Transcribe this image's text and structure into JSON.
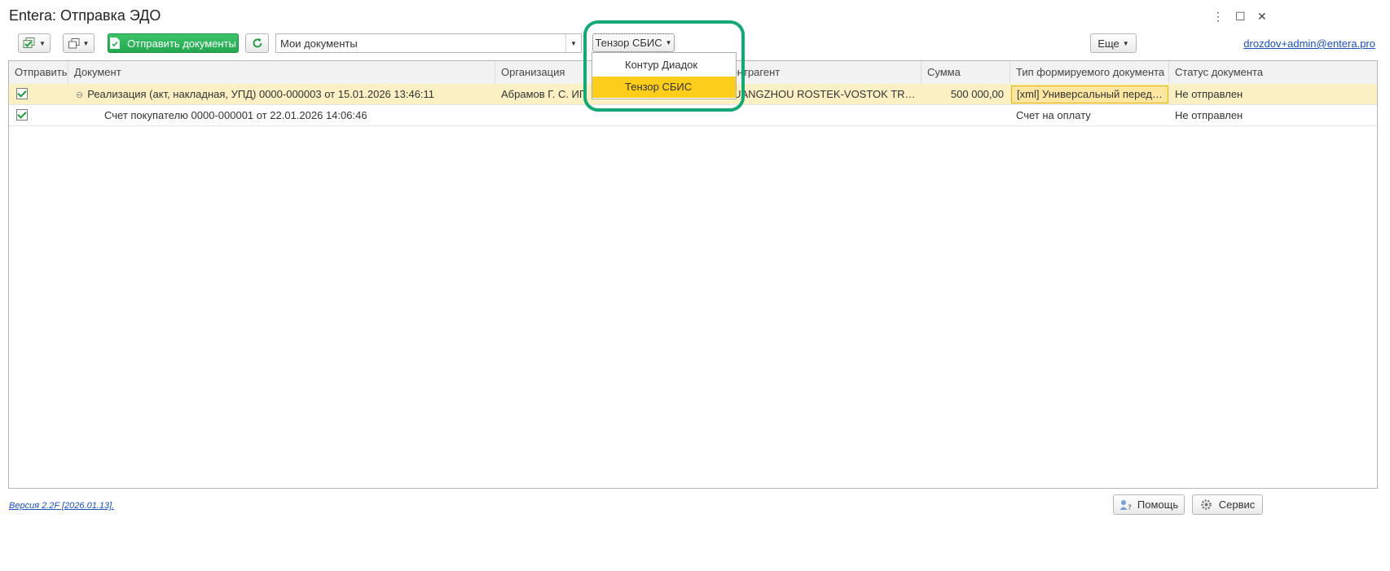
{
  "window": {
    "title": "Entera: Отправка ЭДО"
  },
  "toolbar": {
    "send_label": "Отправить документы",
    "filter_value": "Мои документы",
    "provider_label": "Тензор СБИС",
    "more_label": "Еще",
    "user_link": "drozdov+admin@entera.pro"
  },
  "provider_menu": {
    "items": [
      "Контур Диадок",
      "Тензор СБИС"
    ],
    "active": "Тензор СБИС"
  },
  "table": {
    "columns": [
      "Отправить",
      "Документ",
      "Организация",
      "Контрагент",
      "Сумма",
      "Тип формируемого документа",
      "Статус документа"
    ],
    "rows": [
      {
        "send": true,
        "document": "Реализация (акт, накладная, УПД) 0000-000003 от 15.01.2026 13:46:11",
        "organization": "Абрамов Г. С. ИП",
        "contractor": "GUANGZHOU ROSTEK-VOSTOK TRADE ...",
        "amount": "500 000,00",
        "doc_type": "[xml] Универсальный передат...",
        "status": "Не отправлен"
      },
      {
        "send": true,
        "document": "Счет покупателю 0000-000001 от 22.01.2026 14:06:46",
        "organization": "",
        "contractor": "",
        "amount": "",
        "doc_type": "Счет на оплату",
        "status": "Не отправлен"
      }
    ]
  },
  "footer": {
    "version": "Версия 2.2F [2026.01.13].",
    "help_label": "Помощь",
    "service_label": "Сервис"
  },
  "colors": {
    "accent_green": "#22a84f",
    "highlight_frame": "#14a974",
    "menu_active": "#fdcd1c",
    "selected_row": "#fbf0c4"
  }
}
